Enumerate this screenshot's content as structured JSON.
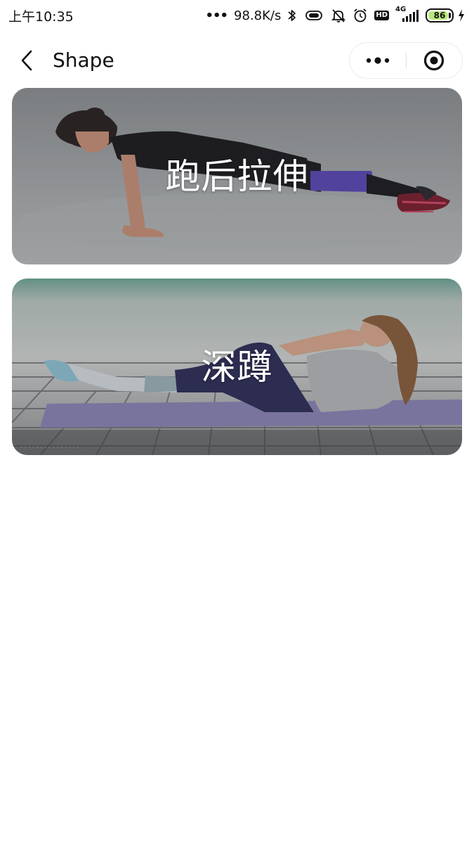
{
  "status_bar": {
    "time": "上午10:35",
    "network_speed": "98.8K/s",
    "signal_label": "4G",
    "battery_level": "86",
    "battery_fraction": 0.86,
    "icons": [
      "more-dots-icon",
      "bluetooth-icon",
      "vibrate-icon",
      "mute-icon",
      "alarm-icon",
      "hd-icon",
      "signal-icon",
      "battery-icon",
      "charging-icon"
    ],
    "hd_label": "HD"
  },
  "nav": {
    "title": "Shape",
    "back_icon": "chevron-left-icon",
    "menu_icon": "more-icon",
    "close_icon": "target-icon"
  },
  "cards": [
    {
      "title": "跑后拉伸",
      "image": "plank-exercise-photo"
    },
    {
      "title": "深蹲",
      "image": "bicycle-crunch-photo"
    }
  ],
  "colors": {
    "background": "#ffffff",
    "card_title": "#ffffff",
    "battery_fill": "#b9e77b"
  }
}
